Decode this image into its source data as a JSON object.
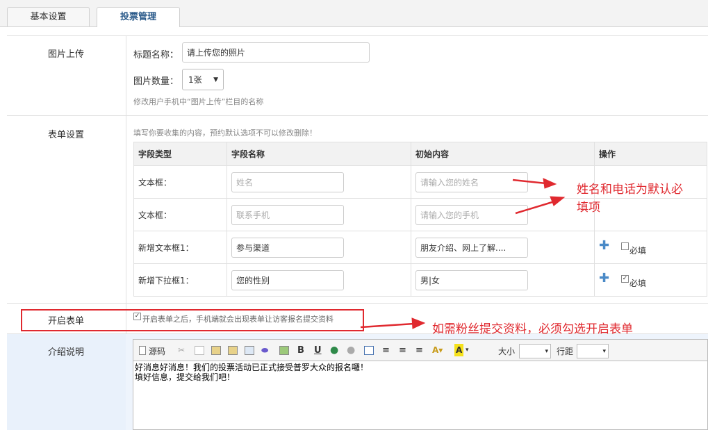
{
  "tabs": [
    {
      "label": "基本设置"
    },
    {
      "label": "投票管理"
    }
  ],
  "photo_upload": {
    "section_label": "图片上传",
    "title_label": "标题名称：",
    "title_value": "请上传您的照片",
    "count_label": "图片数量：",
    "count_value": "1张",
    "hint": "修改用户手机中“图片上传”栏目的名称"
  },
  "form_settings": {
    "section_label": "表单设置",
    "hint": "填写你要收集的内容，预约默认选项不可以修改删除！",
    "headers": [
      "字段类型",
      "字段名称",
      "初始内容",
      "操作"
    ],
    "rows": [
      {
        "type": "文本框：",
        "name": "姓名",
        "initial": "请输入您的姓名"
      },
      {
        "type": "文本框：",
        "name": "联系手机",
        "initial": "请输入您的手机"
      },
      {
        "type": "新增文本框1：",
        "name": "参与渠道",
        "initial": "朋友介绍、网上了解....",
        "required_label": "必填"
      },
      {
        "type": "新增下拉框1：",
        "name": "您的性别",
        "initial": "男|女",
        "required_label": "必填"
      }
    ]
  },
  "enable_form": {
    "section_label": "开启表单",
    "checkbox_label": "开启表单之后，手机端就会出现表单让访客报名提交资料"
  },
  "intro": {
    "section_label": "介绍说明",
    "toolbar": {
      "source": "源码",
      "bold": "B",
      "underline": "U",
      "size_label": "大小",
      "line_height_label": "行距"
    },
    "content_line1": "好消息好消息！我们的投票活动已正式接受普罗大众的报名囉！",
    "content_line2": "填好信息，提交给我们吧！"
  },
  "annotations": {
    "note1_line1": "姓名和电话为默认必",
    "note1_line2": "填项",
    "note2": "如需粉丝提交资料，必须勾选开启表单"
  },
  "colors": {
    "annotation_red": "#e0292f",
    "tab_active_text": "#2a5a8a",
    "plus_blue": "#4a8ac7"
  }
}
